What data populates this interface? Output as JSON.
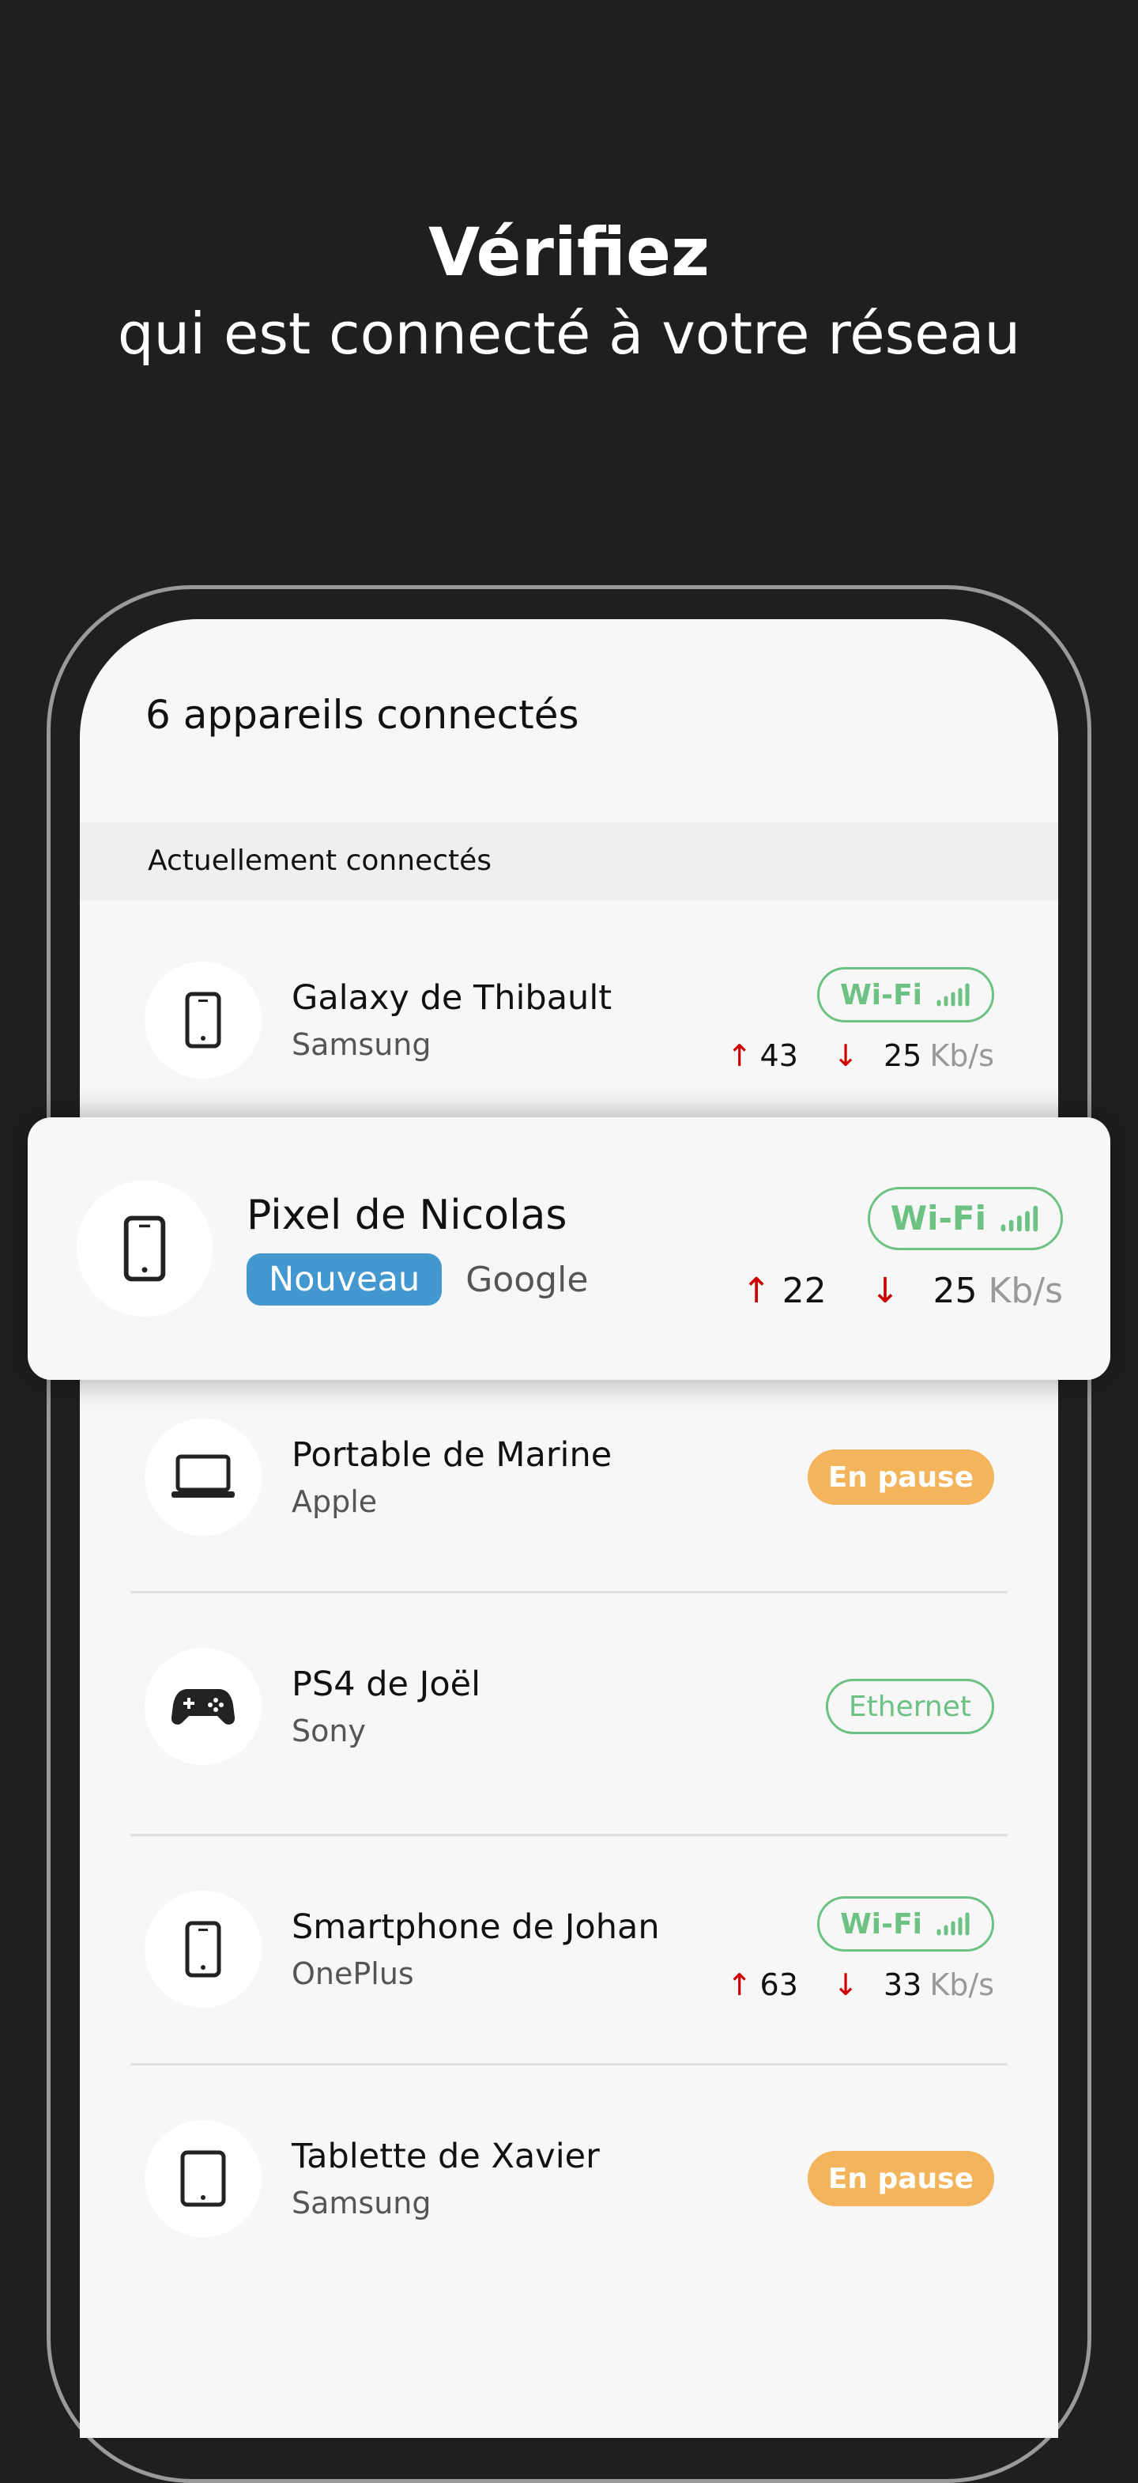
{
  "header": {
    "title": "Vérifiez",
    "subtitle": "qui est connecté à votre réseau"
  },
  "screen": {
    "count_title": "6 appareils connectés",
    "section_label": "Actuellement connectés"
  },
  "unit": "Kb/s",
  "colors": {
    "wifi_green": "#6cc183",
    "pause_orange": "#f3b45c",
    "new_blue": "#4398d0",
    "arrow_red": "#cc0000"
  },
  "devices": [
    {
      "name": "Galaxy de Thibault",
      "brand": "Samsung",
      "icon": "smartphone-icon",
      "status": "Wi-Fi",
      "up": "43",
      "down": "25"
    },
    {
      "name": "Pixel de Nicolas",
      "brand": "Google",
      "icon": "smartphone-icon",
      "status": "Wi-Fi",
      "up": "22",
      "down": "25",
      "tag": "Nouveau"
    },
    {
      "name": "Portable de Marine",
      "brand": "Apple",
      "icon": "laptop-icon",
      "status": "En pause"
    },
    {
      "name": "PS4 de Joël",
      "brand": "Sony",
      "icon": "gamepad-icon",
      "status": "Ethernet"
    },
    {
      "name": "Smartphone de Johan",
      "brand": "OnePlus",
      "icon": "smartphone-icon",
      "status": "Wi-Fi",
      "up": "63",
      "down": "33"
    },
    {
      "name": "Tablette de Xavier",
      "brand": "Samsung",
      "icon": "tablet-icon",
      "status": "En pause"
    }
  ]
}
